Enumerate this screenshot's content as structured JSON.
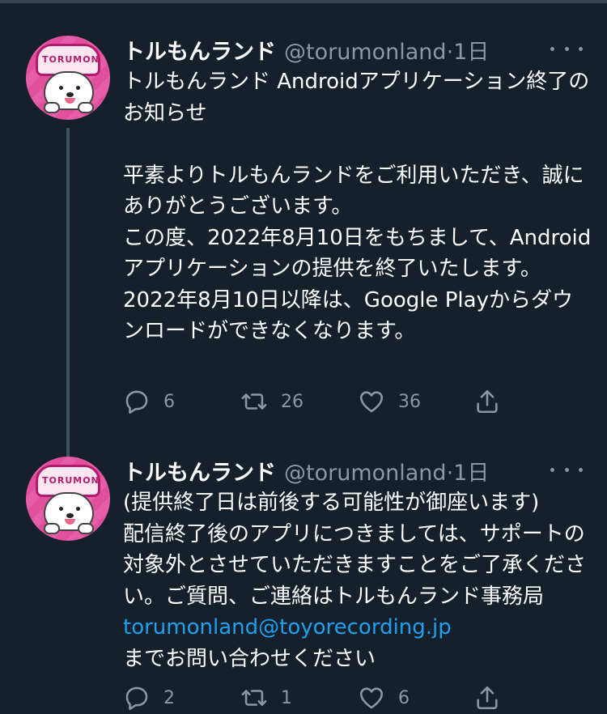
{
  "tweets": [
    {
      "name": "トルもんランド",
      "handle": "@torumonland",
      "time": "1日",
      "avatar_badge": "TORUMON",
      "text": "トルもんランド Androidアプリケーション終了のお知らせ\n\n平素よりトルもんランドをご利用いただき、誠にありがとうございます。\nこの度、2022年8月10日をもちまして、Androidアプリケーションの提供を終了いたします。\n2022年8月10日以降は、Google Playからダウンロードができなくなります。",
      "replies": "6",
      "retweets": "26",
      "likes": "36"
    },
    {
      "name": "トルもんランド",
      "handle": "@torumonland",
      "time": "1日",
      "avatar_badge": "TORUMON",
      "text_before_link": "(提供終了日は前後する可能性が御座います)\n配信終了後のアプリにつきましては、サポートの対象外とさせていただきますことをご了承ください。ご質問、ご連絡はトルもんランド事務局 ",
      "link": "torumonland@toyorecording.jp",
      "text_after_link": "\nまでお問い合わせください",
      "replies": "2",
      "retweets": "1",
      "likes": "6"
    }
  ],
  "colors": {
    "background": "#15202b",
    "secondary_text": "#8899a6",
    "link": "#1da1f2",
    "thread_line": "#3d5466"
  },
  "icons": [
    "reply-icon",
    "retweet-icon",
    "like-icon",
    "share-icon",
    "more-icon"
  ]
}
